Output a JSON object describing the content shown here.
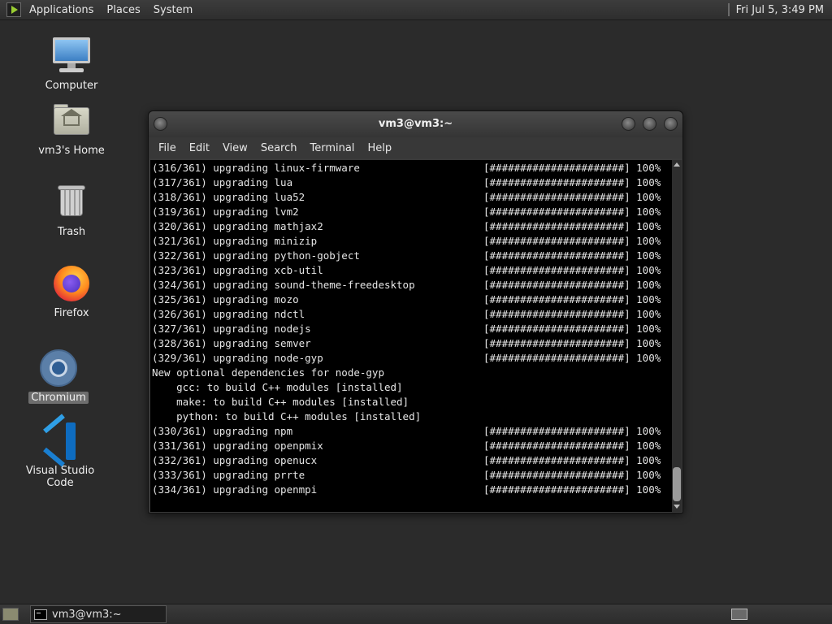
{
  "top_panel": {
    "menus": [
      "Applications",
      "Places",
      "System"
    ],
    "clock": "Fri Jul  5,  3:49 PM"
  },
  "desktop_icons": [
    {
      "label": "Computer",
      "icon": "computer-icon"
    },
    {
      "label": "vm3's Home",
      "icon": "home-folder-icon"
    },
    {
      "label": "Trash",
      "icon": "trash-icon"
    },
    {
      "label": "Firefox",
      "icon": "firefox-icon"
    },
    {
      "label": "Chromium",
      "icon": "chromium-icon",
      "selected": true
    },
    {
      "label": "Visual Studio Code",
      "icon": "vscode-icon"
    }
  ],
  "terminal": {
    "title": "vm3@vm3:~",
    "menu": [
      "File",
      "Edit",
      "View",
      "Search",
      "Terminal",
      "Help"
    ],
    "lines": [
      {
        "l": "(316/361) upgrading linux-firmware",
        "r": "[######################] 100%"
      },
      {
        "l": "(317/361) upgrading lua",
        "r": "[######################] 100%"
      },
      {
        "l": "(318/361) upgrading lua52",
        "r": "[######################] 100%"
      },
      {
        "l": "(319/361) upgrading lvm2",
        "r": "[######################] 100%"
      },
      {
        "l": "(320/361) upgrading mathjax2",
        "r": "[######################] 100%"
      },
      {
        "l": "(321/361) upgrading minizip",
        "r": "[######################] 100%"
      },
      {
        "l": "(322/361) upgrading python-gobject",
        "r": "[######################] 100%"
      },
      {
        "l": "(323/361) upgrading xcb-util",
        "r": "[######################] 100%"
      },
      {
        "l": "(324/361) upgrading sound-theme-freedesktop",
        "r": "[######################] 100%"
      },
      {
        "l": "(325/361) upgrading mozo",
        "r": "[######################] 100%"
      },
      {
        "l": "(326/361) upgrading ndctl",
        "r": "[######################] 100%"
      },
      {
        "l": "(327/361) upgrading nodejs",
        "r": "[######################] 100%"
      },
      {
        "l": "(328/361) upgrading semver",
        "r": "[######################] 100%"
      },
      {
        "l": "(329/361) upgrading node-gyp",
        "r": "[######################] 100%"
      },
      {
        "l": "New optional dependencies for node-gyp",
        "r": ""
      },
      {
        "l": "    gcc: to build C++ modules [installed]",
        "r": ""
      },
      {
        "l": "    make: to build C++ modules [installed]",
        "r": ""
      },
      {
        "l": "    python: to build C++ modules [installed]",
        "r": ""
      },
      {
        "l": "(330/361) upgrading npm",
        "r": "[######################] 100%"
      },
      {
        "l": "(331/361) upgrading openpmix",
        "r": "[######################] 100%"
      },
      {
        "l": "(332/361) upgrading openucx",
        "r": "[######################] 100%"
      },
      {
        "l": "(333/361) upgrading prrte",
        "r": "[######################] 100%"
      },
      {
        "l": "(334/361) upgrading openmpi",
        "r": "[######################] 100%"
      }
    ]
  },
  "taskbar": {
    "items": [
      {
        "label": "vm3@vm3:~"
      }
    ]
  }
}
